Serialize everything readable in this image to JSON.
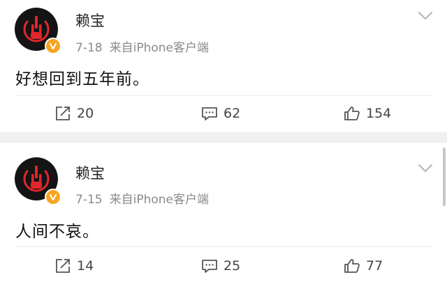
{
  "posts": [
    {
      "author": "赖宝",
      "date": "7-18",
      "source": "来自iPhone客户端",
      "text": "好想回到五年前。",
      "reposts": "20",
      "comments": "62",
      "likes": "154"
    },
    {
      "author": "赖宝",
      "date": "7-15",
      "source": "来自iPhone客户端",
      "text": "人间不哀。",
      "reposts": "14",
      "comments": "25",
      "likes": "77"
    }
  ],
  "colors": {
    "avatar_bg": "#141414",
    "avatar_accent": "#e3262b",
    "verified_badge": "#f6a623",
    "meta_text": "#8a8a8a"
  },
  "icons": {
    "repost": "repost-icon",
    "comment": "comment-icon",
    "like": "thumbs-up-icon",
    "menu": "chevron-down-icon",
    "verified": "verified-badge-icon"
  }
}
